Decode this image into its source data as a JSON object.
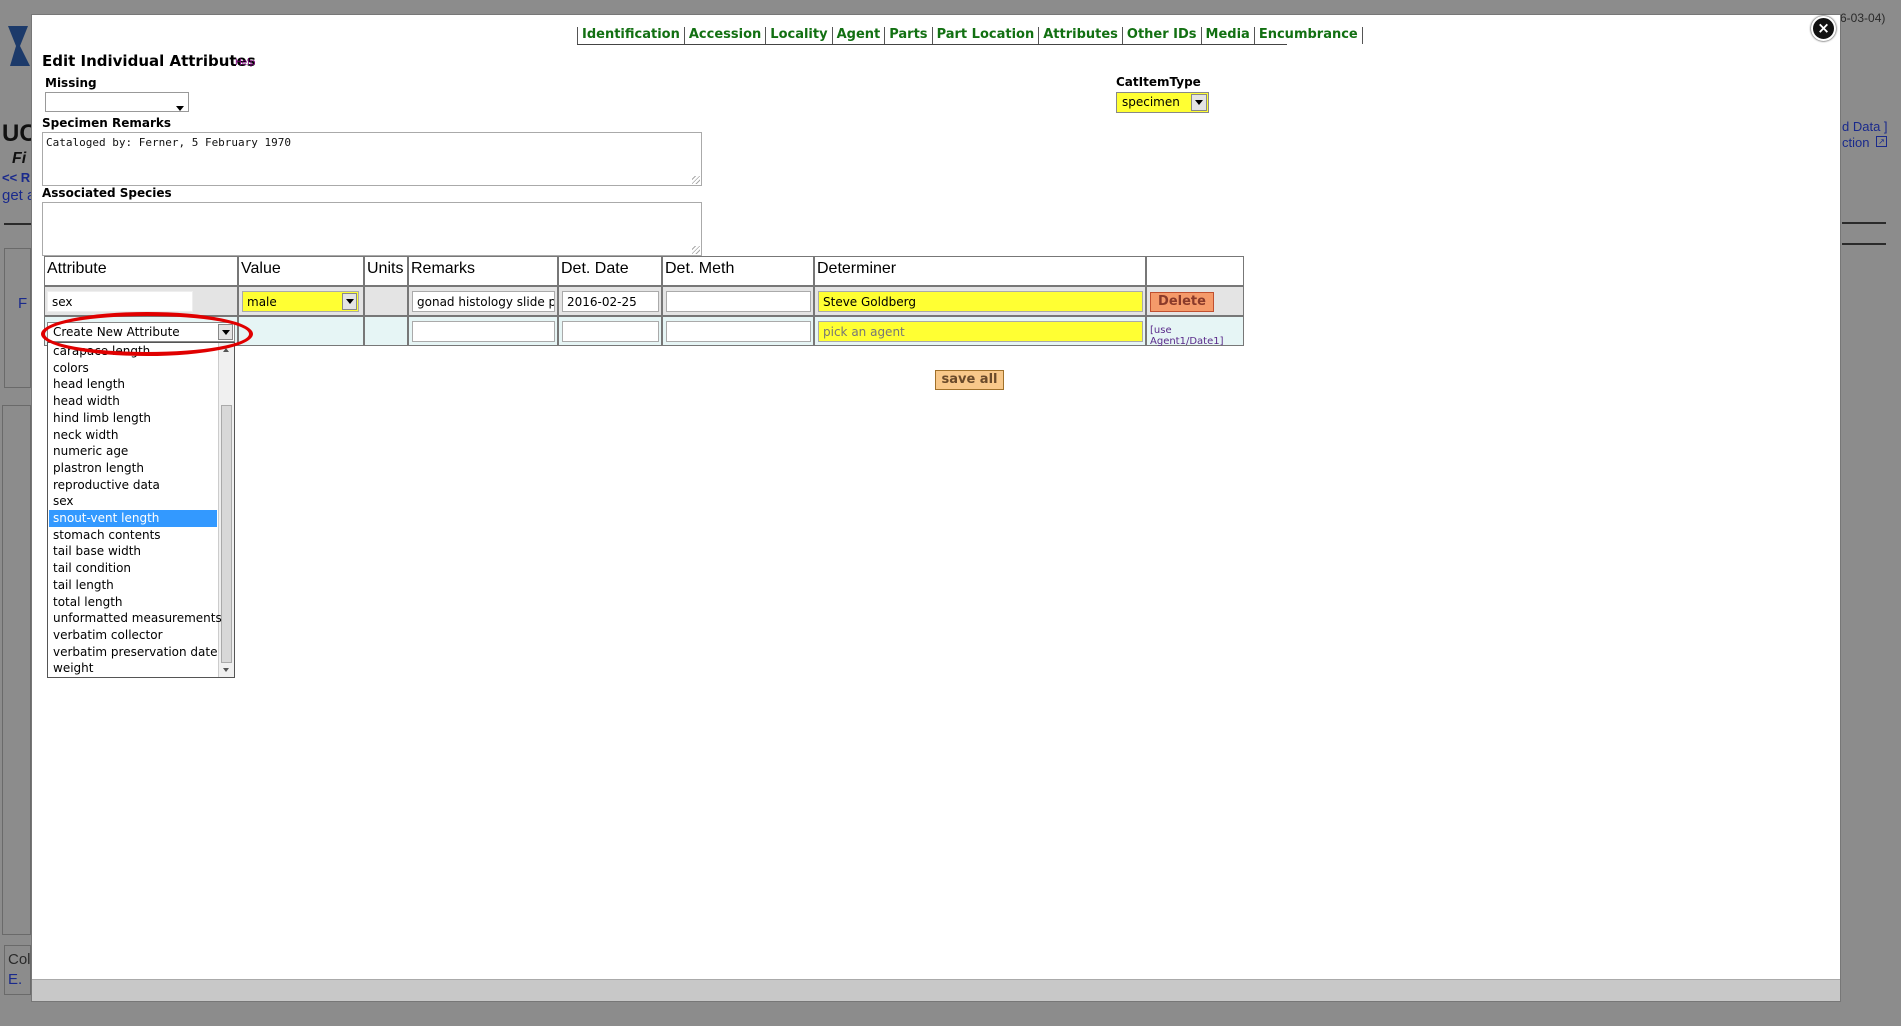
{
  "background": {
    "title_fragment": "UC",
    "subtitle_fragment": "Fi",
    "link1": "<< R",
    "link2": "get a",
    "left_fragment": "F",
    "bottom_frag1": "Col",
    "bottom_frag2": "E. ",
    "right_date": "6-03-04)",
    "right_link1": "d Data ]",
    "right_link2": "ction"
  },
  "topnav": [
    "Identification",
    "Accession",
    "Locality",
    "Agent",
    "Parts",
    "Part Location",
    "Attributes",
    "Other IDs",
    "Media",
    "Encumbrance"
  ],
  "close_label": "×",
  "page_title": "Edit Individual Attributes",
  "help_label": "Help",
  "missing": {
    "label": "Missing",
    "value": ""
  },
  "catitemtype": {
    "label": "CatItemType",
    "value": "specimen"
  },
  "specimen_remarks": {
    "label": "Specimen Remarks",
    "value": "Cataloged by: Ferner, 5 February 1970"
  },
  "associated_species": {
    "label": "Associated Species",
    "value": ""
  },
  "table": {
    "headers": [
      "Attribute",
      "Value",
      "Units",
      "Remarks",
      "Det. Date",
      "Det. Meth",
      "Determiner",
      ""
    ],
    "row1": {
      "attribute": "sex",
      "value": "male",
      "units": "",
      "remarks": "gonad histology slide pr",
      "det_date": "2016-02-25",
      "det_meth": "",
      "determiner": "Steve Goldberg",
      "action": "Delete"
    },
    "row2": {
      "attribute": "Create New Attribute",
      "determiner_placeholder": "pick an agent",
      "use_link": "[use Agent1/Date1]"
    }
  },
  "save_all": "save all",
  "dropdown": {
    "selected": "snout-vent length",
    "options": [
      "carapace length",
      "colors",
      "head length",
      "head width",
      "hind limb length",
      "neck width",
      "numeric age",
      "plastron length",
      "reproductive data",
      "sex",
      "snout-vent length",
      "stomach contents",
      "tail base width",
      "tail condition",
      "tail length",
      "total length",
      "unformatted measurements",
      "verbatim collector",
      "verbatim preservation date",
      "weight"
    ]
  },
  "colors": {
    "highlight_yellow": "#ffff33",
    "nav_green": "#127012",
    "selected_blue": "#3399ff",
    "annotation_red": "#e00000"
  }
}
